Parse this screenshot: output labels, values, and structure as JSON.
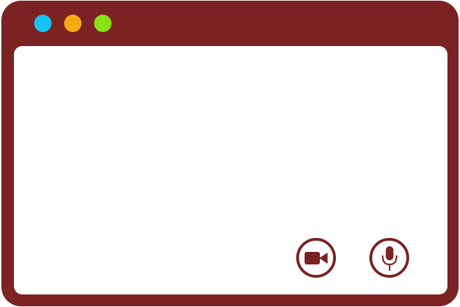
{
  "colors": {
    "window_frame": "#7b2222",
    "content_background": "#ffffff",
    "control_accent": "#7b2222",
    "close_dot": "#16c3f3",
    "minimize_dot": "#f6ab14",
    "maximize_dot": "#8ae214"
  },
  "titlebar": {
    "buttons": [
      {
        "name": "close",
        "color": "#16c3f3"
      },
      {
        "name": "minimize",
        "color": "#f6ab14"
      },
      {
        "name": "maximize",
        "color": "#8ae214"
      }
    ]
  },
  "controls": {
    "video": {
      "icon": "video-camera-icon"
    },
    "mic": {
      "icon": "microphone-icon"
    }
  }
}
